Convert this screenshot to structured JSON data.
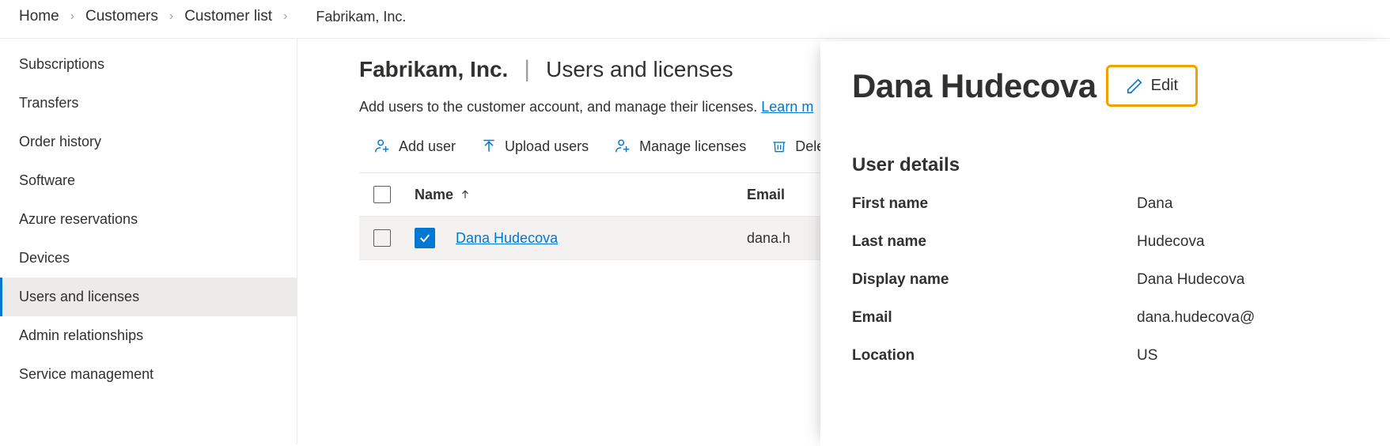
{
  "breadcrumb": {
    "items": [
      "Home",
      "Customers",
      "Customer list"
    ],
    "current": "Fabrikam, Inc."
  },
  "sidebar": {
    "items": [
      {
        "label": "Subscriptions"
      },
      {
        "label": "Transfers"
      },
      {
        "label": "Order history"
      },
      {
        "label": "Software"
      },
      {
        "label": "Azure reservations"
      },
      {
        "label": "Devices"
      },
      {
        "label": "Users and licenses"
      },
      {
        "label": "Admin relationships"
      },
      {
        "label": "Service management"
      }
    ],
    "activeIndex": 6
  },
  "main": {
    "customer": "Fabrikam, Inc.",
    "section": "Users and licenses",
    "subtitle_text": "Add users to the customer account, and manage their licenses. ",
    "learn_more": "Learn m",
    "toolbar": {
      "add_user": "Add user",
      "upload_users": "Upload users",
      "manage_licenses": "Manage licenses",
      "delete": "Delete"
    },
    "table": {
      "columns": {
        "name": "Name",
        "email": "Email"
      },
      "rows": [
        {
          "name": "Dana Hudecova",
          "email": "dana.h",
          "selected": true
        }
      ]
    }
  },
  "panel": {
    "title": "Dana Hudecova",
    "edit_label": "Edit",
    "details_heading": "User details",
    "fields": {
      "first_name_label": "First name",
      "first_name_value": "Dana",
      "last_name_label": "Last name",
      "last_name_value": "Hudecova",
      "display_name_label": "Display name",
      "display_name_value": "Dana Hudecova",
      "email_label": "Email",
      "email_value": "dana.hudecova@",
      "location_label": "Location",
      "location_value": "US"
    }
  }
}
